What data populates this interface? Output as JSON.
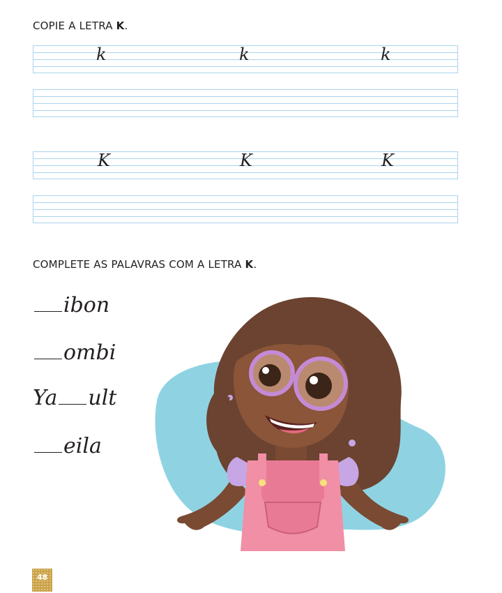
{
  "section1": {
    "heading_prefix": "COPIE A LETRA ",
    "heading_letter": "K",
    "heading_suffix": ".",
    "lowercase_model": "k",
    "uppercase_model": "K"
  },
  "section2": {
    "heading_prefix": "COMPLETE AS PALAVRAS COM A LETRA ",
    "heading_letter": "K",
    "heading_suffix": ".",
    "words": [
      {
        "before": "",
        "after": "ibon"
      },
      {
        "before": "",
        "after": "ombi"
      },
      {
        "before": "Ya",
        "after": "ult"
      },
      {
        "before": "",
        "after": "eila"
      }
    ]
  },
  "page_number": "48",
  "colors": {
    "guide_lines": "#a9d3ec",
    "page_badge": "#c9a24a",
    "blob": "#8fd3e3"
  }
}
